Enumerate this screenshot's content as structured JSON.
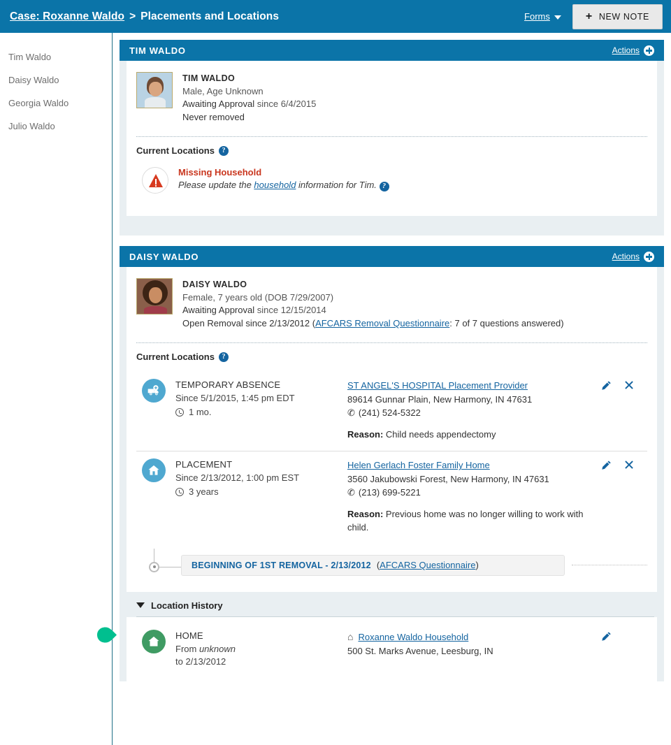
{
  "topbar": {
    "case_link": "Case: Roxanne Waldo",
    "separator": ">",
    "current_page": "Placements and Locations",
    "forms_label": "Forms",
    "new_note_label": "NEW NOTE",
    "new_note_plus": "+",
    "brand_color": "#0b74a8"
  },
  "sidebar": {
    "items": [
      {
        "label": "Tim Waldo"
      },
      {
        "label": "Daisy Waldo"
      },
      {
        "label": "Georgia Waldo"
      },
      {
        "label": "Julio Waldo"
      }
    ]
  },
  "cards": [
    {
      "header_title": "TIM WALDO",
      "actions_label": "Actions",
      "person": {
        "name": "TIM WALDO",
        "demographics": "Male, Age Unknown",
        "status_prefix": "Awaiting Approval",
        "status_since": "since 6/4/2015",
        "removal_line": "Never removed"
      },
      "current_locations_label": "Current Locations",
      "alert": {
        "title": "Missing Household",
        "text_before": "Please update the ",
        "link": "household",
        "text_after": " information for Tim."
      }
    },
    {
      "header_title": "DAISY WALDO",
      "actions_label": "Actions",
      "person": {
        "name": "DAISY WALDO",
        "demographics": "Female, 7 years old (DOB 7/29/2007)",
        "status_prefix": "Awaiting Approval",
        "status_since": "since 12/15/2014",
        "removal_prefix": "Open Removal since 2/13/2012 (",
        "removal_link": "AFCARS Removal Questionnaire",
        "removal_suffix": ": 7 of 7 questions answered)"
      },
      "current_locations_label": "Current Locations",
      "locations": [
        {
          "icon": "ambulance-icon",
          "type": "TEMPORARY ABSENCE",
          "since": "Since 5/1/2015, 1:45 pm EDT",
          "duration": "1 mo.",
          "provider_link": "ST ANGEL'S HOSPITAL Placement Provider",
          "address": "89614 Gunnar Plain, New Harmony, IN 47631",
          "phone": "(241) 524-5322",
          "reason_label": "Reason:",
          "reason_text": "Child needs appendectomy"
        },
        {
          "icon": "house-icon",
          "type": "PLACEMENT",
          "since": "Since 2/13/2012, 1:00 pm EST",
          "duration": "3 years",
          "provider_link": "Helen Gerlach Foster Family Home",
          "address": "3560 Jakubowski Forest, New Harmony, IN 47631",
          "phone": "(213) 699-5221",
          "reason_label": "Reason:",
          "reason_text": "Previous home was no longer willing to work with child."
        }
      ],
      "timeline": {
        "title": "BEGINNING OF 1ST REMOVAL - 2/13/2012",
        "link_open": "(",
        "link": "AFCARS Questionnaire",
        "link_close": ")"
      },
      "location_history": {
        "label": "Location History",
        "entries": [
          {
            "icon": "home-icon",
            "type": "HOME",
            "from_prefix": "From ",
            "from_value": "unknown",
            "to_line": "to 2/13/2012",
            "household_link": "Roxanne Waldo Household",
            "address": "500 St. Marks Avenue, Leesburg, IN"
          }
        ]
      }
    }
  ],
  "icons": {
    "edit": "✎",
    "remove": "✖",
    "phone": "✆",
    "help": "?",
    "house_small": "⌂"
  }
}
